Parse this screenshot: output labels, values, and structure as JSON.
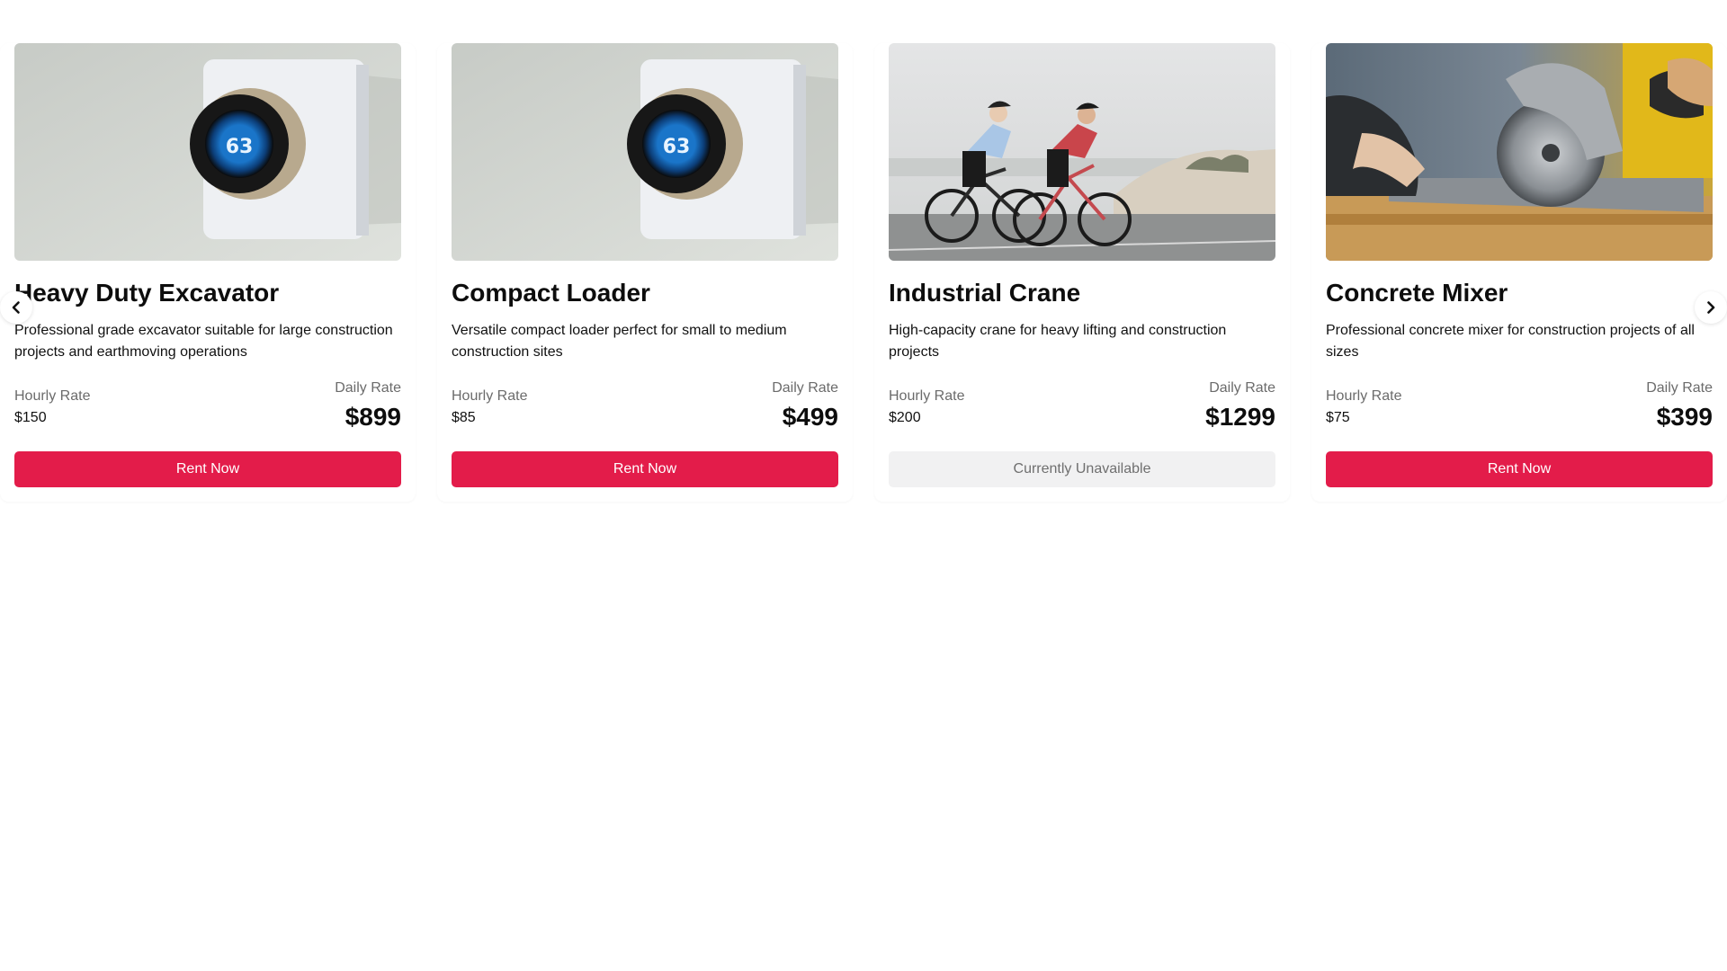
{
  "carousel": {
    "prev_icon": "chevron-left-icon",
    "next_icon": "chevron-right-icon",
    "cards": [
      {
        "title": "Heavy Duty Excavator",
        "description": "Professional grade excavator suitable for large construction projects and earthmoving operations",
        "hourly_label": "Hourly Rate",
        "hourly_value": "$150",
        "daily_label": "Daily Rate",
        "daily_value": "$899",
        "button_label": "Rent Now",
        "available": true,
        "image": "thermostat-photo"
      },
      {
        "title": "Compact Loader",
        "description": "Versatile compact loader perfect for small to medium construction sites",
        "hourly_label": "Hourly Rate",
        "hourly_value": "$85",
        "daily_label": "Daily Rate",
        "daily_value": "$499",
        "button_label": "Rent Now",
        "available": true,
        "image": "thermostat-photo"
      },
      {
        "title": "Industrial Crane",
        "description": "High-capacity crane for heavy lifting and construction projects",
        "hourly_label": "Hourly Rate",
        "hourly_value": "$200",
        "daily_label": "Daily Rate",
        "daily_value": "$1299",
        "button_label": "Currently Unavailable",
        "available": false,
        "image": "cyclists-photo"
      },
      {
        "title": "Concrete Mixer",
        "description": "Professional concrete mixer for construction projects of all sizes",
        "hourly_label": "Hourly Rate",
        "hourly_value": "$75",
        "daily_label": "Daily Rate",
        "daily_value": "$399",
        "button_label": "Rent Now",
        "available": true,
        "image": "circular-saw-photo"
      }
    ]
  },
  "colors": {
    "accent": "#e31c4a",
    "disabled_bg": "#f1f1f2",
    "muted_text": "#6b6b6b"
  }
}
